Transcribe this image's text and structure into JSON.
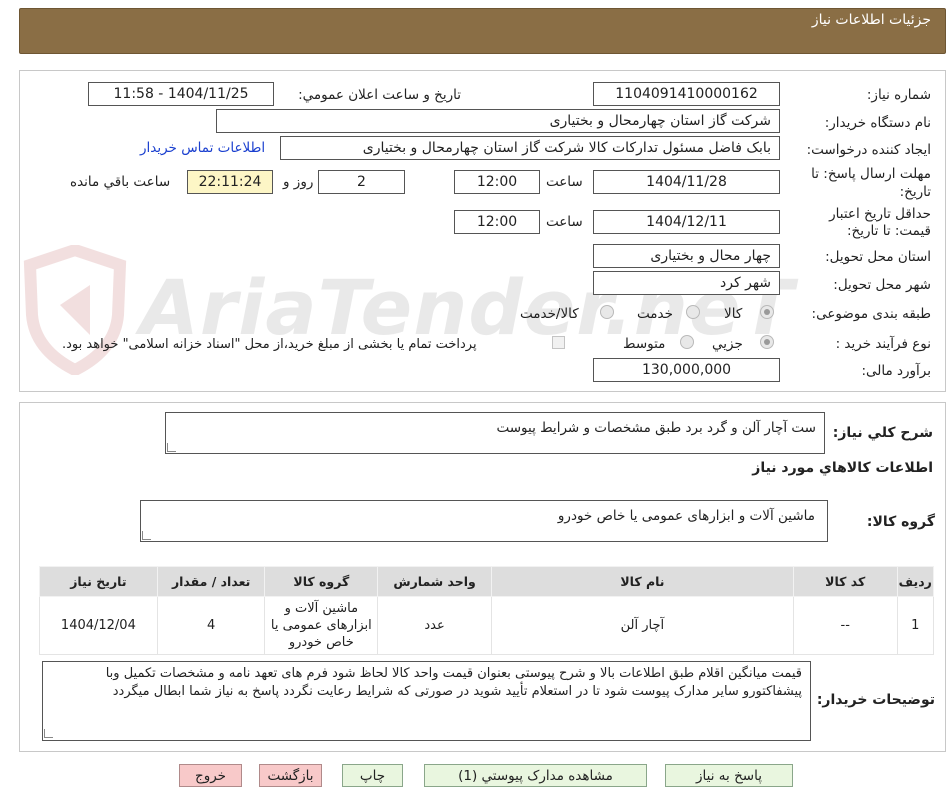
{
  "header": {
    "title": "جزئیات اطلاعات نیاز"
  },
  "form": {
    "need_number_label": "شماره نیاز:",
    "need_number": "1104091410000162",
    "announce_label": "تاريخ و ساعت اعلان عمومي:",
    "announce_value": "1404/11/25 - 11:58",
    "buyer_org_label": "نام دستگاه خريدار:",
    "buyer_org": "شرکت گاز استان چهارمحال و بختیاری",
    "creator_label": "ايجاد کننده درخواست:",
    "creator": "بابک فاضل  مسئول تدارکات کالا شرکت گاز استان چهارمحال و بختیاری",
    "contact_link": "اطلاعات تماس خريدار",
    "deadline_label_1": "مهلت ارسال پاسخ: تا",
    "deadline_label_2": "تاريخ:",
    "deadline_date": "1404/11/28",
    "time_word": "ساعت",
    "deadline_time": "12:00",
    "days_value": "2",
    "days_word": "روز و",
    "remaining_time": "22:11:24",
    "remaining_word": "ساعت باقي مانده",
    "validity_label_1": "حداقل تاريخ اعتبار",
    "validity_label_2": "قيمت: تا تاريخ:",
    "validity_date": "1404/12/11",
    "validity_time": "12:00",
    "province_label": "استان محل تحويل:",
    "province": "چهار محال و بختیاری",
    "city_label": "شهر محل تحويل:",
    "city": "شهر کرد",
    "category_label": "طبقه بندی موضوعی:",
    "category_options": [
      "کالا",
      "خدمت",
      "کالا/خدمت"
    ],
    "process_label": "نوع فرآيند خريد :",
    "process_options": [
      "جزيي",
      "متوسط"
    ],
    "payment_note": "پرداخت تمام يا بخشی از مبلغ خريد،از محل \"اسناد خزانه اسلامی\" خواهد بود.",
    "budget_label": "برآورد مالی:",
    "budget": "130,000,000"
  },
  "details": {
    "general_desc_label": "شرح کلي نياز:",
    "general_desc": "ست آچار آلن و گرد برد طبق مشخصات و شرایط پیوست",
    "goods_info_title": "اطلاعات کالاهاي مورد نياز",
    "goods_group_label": "گروه کالا:",
    "goods_group": "ماشین آلات و ابزارهای عمومی یا خاص خودرو",
    "table": {
      "headers": [
        "رديف",
        "کد کالا",
        "نام کالا",
        "واحد شمارش",
        "گروه کالا",
        "تعداد / مقدار",
        "تاريخ نياز"
      ],
      "rows": [
        [
          "1",
          "--",
          "آچار آلن",
          "عدد",
          "ماشین آلات و ابزارهای عمومی یا خاص خودرو",
          "4",
          "1404/12/04"
        ]
      ]
    },
    "buyer_notes_label": "توضيحات خريدار:",
    "buyer_notes": "قیمت میانگین اقلام طبق اطلاعات بالا و شرح پیوستی بعنوان قیمت واحد  کالا  لحاظ شود فرم های تعهد نامه و مشخصات تکمیل وبا پیشفاکتورو سایر مدارک پیوست شود تا در استعلام تأیید شوید در صورتی که شرایط رعایت نگردد پاسخ به نیاز شما ابطال میگردد"
  },
  "buttons": {
    "respond": "پاسخ به نياز",
    "attachments": "مشاهده مدارک پيوستي (1)",
    "print": "چاپ",
    "back": "بازگشت",
    "exit": "خروج"
  },
  "watermark": {
    "text": "AriaTender.neT"
  }
}
